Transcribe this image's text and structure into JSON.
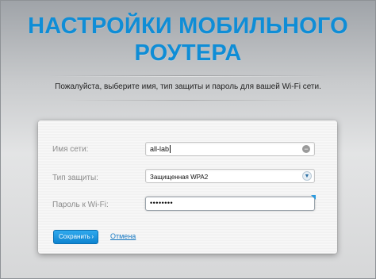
{
  "header": {
    "title_line1": "НАСТРОЙКИ МОБИЛЬНОГО",
    "title_line2": "РОУТЕРА",
    "subtitle": "Пожалуйста, выберите имя, тип защиты и пароль для вашей Wi-Fi сети."
  },
  "form": {
    "ssid": {
      "label": "Имя сети:",
      "value": "all-lab"
    },
    "security": {
      "label": "Тип защиты:",
      "value": "Защищенная WPA2"
    },
    "password": {
      "label": "Пароль к Wi-Fi:",
      "value": "••••••••"
    }
  },
  "actions": {
    "save_label": "Сохранить",
    "cancel_label": "Отмена"
  },
  "colors": {
    "accent": "#0f8dd6",
    "button": "#1a96e0"
  },
  "icons": {
    "clear": "clear-icon",
    "dropdown": "chevron-down-icon",
    "save_arrow": "arrow-right-icon"
  }
}
